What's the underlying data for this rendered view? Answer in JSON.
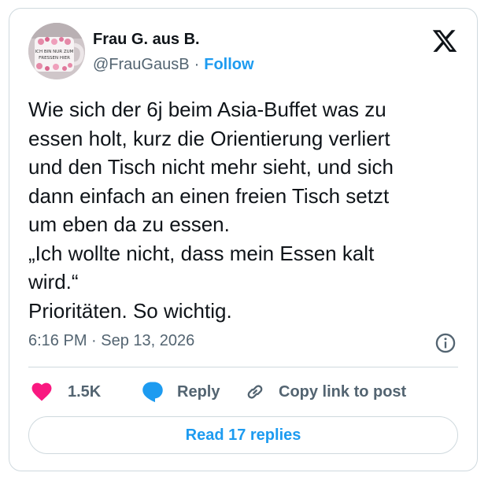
{
  "author": {
    "display_name": "Frau G. aus B.",
    "handle": "@FrauGausB",
    "separator": "·",
    "follow_label": "Follow",
    "avatar": {
      "icon": "mug-photo-avatar",
      "mug_text_line1": "ICH BIN NUR ZUM",
      "mug_text_line2": "FRESSEN HIER"
    }
  },
  "brand": {
    "icon": "x-logo-icon"
  },
  "tweet": {
    "text": "Wie sich der 6j beim Asia-Buffet was zu\nessen holt, kurz die Orientierung verliert\nund den Tisch nicht mehr sieht, und sich\ndann einfach an einen freien Tisch setzt\num eben da zu essen.\n„Ich wollte nicht, dass mein Essen kalt\nwird.“\nPrioritäten. So wichtig."
  },
  "meta": {
    "time": "6:16 PM",
    "separator": "·",
    "date": "Sep 13, 2026",
    "info_icon": "info-icon"
  },
  "actions": {
    "like": {
      "count": "1.5K",
      "icon": "heart-icon",
      "color": "#f91880"
    },
    "reply": {
      "label": "Reply",
      "icon": "speech-bubble-icon",
      "color": "#1d9bf0"
    },
    "copy": {
      "label": "Copy link to post",
      "icon": "link-icon"
    }
  },
  "read_replies": {
    "label": "Read 17 replies"
  },
  "colors": {
    "accent": "#1d9bf0",
    "text": "#0f1419",
    "secondary": "#536471",
    "border": "#cfd9de",
    "like": "#f91880"
  }
}
